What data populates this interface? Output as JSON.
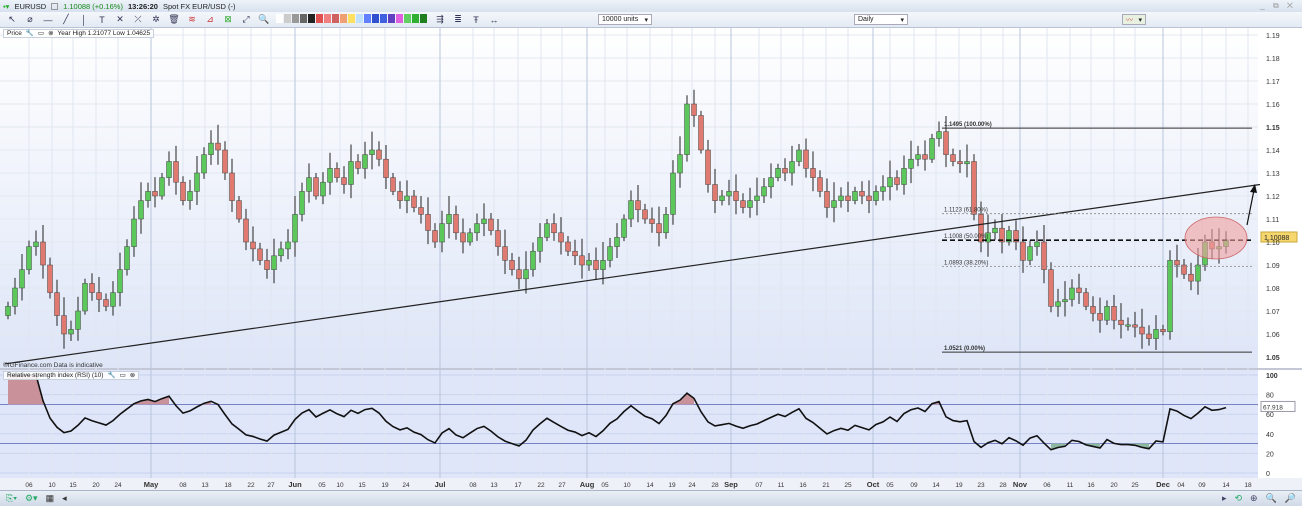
{
  "header": {
    "symbol": "EURUSD",
    "price_change": "1.10088 (+0.16%)",
    "time": "13:26:20",
    "description": "Spot FX EUR/USD (-)"
  },
  "toolbar": {
    "units": "10000 units",
    "interval": "Daily",
    "swatch_colors": [
      "#ffffff",
      "#cccccc",
      "#999999",
      "#666666",
      "#222222",
      "#e05050",
      "#f08080",
      "#d06060",
      "#f0a070",
      "#ffe060",
      "#c0e0ff",
      "#6080ff",
      "#3050d0",
      "#4060e0",
      "#6040c0",
      "#e060e0",
      "#60d060",
      "#30b030",
      "#208020"
    ]
  },
  "price_pane": {
    "label": "Price",
    "year_range": "Year High 1.21077 Low 1.04625",
    "watermark": "©IGFinance.com Data is indicative",
    "current_price": "1.10088"
  },
  "rsi_pane": {
    "label": "Relative strength index (RSI) (10)",
    "current_value": "67.918"
  },
  "chart_data": [
    {
      "type": "candlestick",
      "title": "EURUSD Daily",
      "ylim": [
        1.045,
        1.195
      ],
      "yticks": [
        "1.05",
        "1.06",
        "1.07",
        "1.08",
        "1.09",
        "1.10",
        "1.11",
        "1.12",
        "1.13",
        "1.14",
        "1.15",
        "1.16",
        "1.17",
        "1.18",
        "1.19"
      ],
      "xticks": [
        "06",
        "10",
        "15",
        "20",
        "24",
        "May",
        "08",
        "13",
        "18",
        "22",
        "27",
        "Jun",
        "05",
        "10",
        "15",
        "19",
        "24",
        "Jul",
        "08",
        "13",
        "17",
        "22",
        "27",
        "Aug",
        "05",
        "10",
        "14",
        "19",
        "24",
        "28",
        "Sep",
        "07",
        "11",
        "16",
        "21",
        "25",
        "Oct",
        "05",
        "09",
        "14",
        "19",
        "23",
        "28",
        "Nov",
        "06",
        "11",
        "16",
        "20",
        "25",
        "Dec",
        "04",
        "09",
        "14",
        "18"
      ],
      "closes": [
        1.072,
        1.08,
        1.088,
        1.098,
        1.1,
        1.09,
        1.078,
        1.068,
        1.06,
        1.062,
        1.07,
        1.082,
        1.078,
        1.075,
        1.072,
        1.078,
        1.088,
        1.098,
        1.11,
        1.118,
        1.122,
        1.12,
        1.128,
        1.135,
        1.126,
        1.118,
        1.122,
        1.13,
        1.138,
        1.143,
        1.14,
        1.13,
        1.118,
        1.11,
        1.1,
        1.097,
        1.092,
        1.088,
        1.094,
        1.097,
        1.1,
        1.112,
        1.122,
        1.128,
        1.12,
        1.126,
        1.132,
        1.128,
        1.125,
        1.135,
        1.132,
        1.138,
        1.14,
        1.136,
        1.128,
        1.122,
        1.118,
        1.12,
        1.115,
        1.112,
        1.105,
        1.1,
        1.108,
        1.112,
        1.104,
        1.1,
        1.104,
        1.108,
        1.11,
        1.105,
        1.098,
        1.092,
        1.088,
        1.084,
        1.088,
        1.096,
        1.102,
        1.108,
        1.104,
        1.1,
        1.096,
        1.094,
        1.09,
        1.092,
        1.088,
        1.092,
        1.098,
        1.102,
        1.11,
        1.118,
        1.114,
        1.11,
        1.108,
        1.104,
        1.112,
        1.13,
        1.138,
        1.16,
        1.155,
        1.14,
        1.125,
        1.118,
        1.12,
        1.122,
        1.118,
        1.115,
        1.118,
        1.12,
        1.124,
        1.128,
        1.132,
        1.13,
        1.135,
        1.14,
        1.132,
        1.128,
        1.122,
        1.115,
        1.118,
        1.12,
        1.118,
        1.122,
        1.12,
        1.118,
        1.122,
        1.124,
        1.128,
        1.125,
        1.132,
        1.136,
        1.138,
        1.136,
        1.145,
        1.148,
        1.138,
        1.135,
        1.134,
        1.135,
        1.112,
        1.1,
        1.104,
        1.106,
        1.1,
        1.105,
        1.1,
        1.092,
        1.098,
        1.1,
        1.088,
        1.072,
        1.074,
        1.075,
        1.08,
        1.078,
        1.072,
        1.069,
        1.066,
        1.072,
        1.066,
        1.064,
        1.064,
        1.063,
        1.06,
        1.058,
        1.062,
        1.061,
        1.092,
        1.09,
        1.086,
        1.083,
        1.09,
        1.1,
        1.097,
        1.098,
        1.1009
      ],
      "fibonacci": [
        {
          "price": 1.1495,
          "label": "1.1495 (100.00%)",
          "style": "solid"
        },
        {
          "price": 1.1123,
          "label": "1.1123 (61.80%)",
          "style": "dotted"
        },
        {
          "price": 1.1008,
          "label": "1.1008 (50.00%)",
          "style": "dashed-bold"
        },
        {
          "price": 1.0893,
          "label": "1.0893 (38.20%)",
          "style": "dotted"
        },
        {
          "price": 1.0521,
          "label": "1.0521 (0.00%)",
          "style": "solid"
        }
      ],
      "trendline": {
        "from_price": 1.047,
        "to_price": 1.125
      },
      "colors": {
        "up": "#5cc85c",
        "down": "#e07a70",
        "highlight": "#f0a0a0"
      }
    },
    {
      "type": "line",
      "title": "Relative strength index (RSI) (10)",
      "ylim": [
        0,
        100
      ],
      "yticks": [
        "100",
        "80",
        "60",
        "40",
        "20",
        "0"
      ],
      "overbought": 70,
      "oversold": 30
    }
  ]
}
